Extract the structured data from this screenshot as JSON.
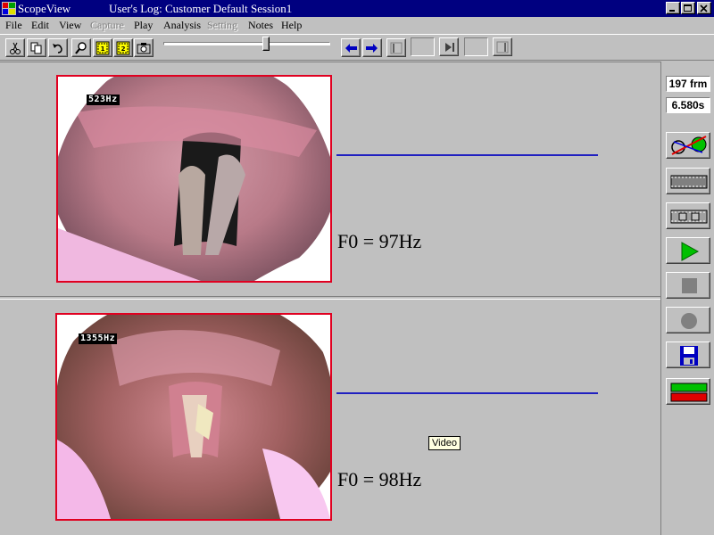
{
  "window": {
    "app_title": "ScopeView",
    "doc_title": "User's Log:  Customer Default Session1"
  },
  "menu": [
    "File",
    "Edit",
    "View",
    "Capture",
    "Play",
    "Analysis",
    "Setting",
    "Notes",
    "Help"
  ],
  "menu_disabled": [
    "Capture",
    "Setting"
  ],
  "toolbar": {
    "icons": [
      "cut-icon",
      "copy-icon",
      "undo-icon",
      "zoom-icon",
      "calibrate-1-icon",
      "calibrate-2-icon",
      "camera-icon"
    ],
    "slider_position": 0.62,
    "nav_icons": [
      "arrow-left-icon",
      "arrow-right-icon",
      "frame-start-icon",
      "frame-end-icon",
      "fullscreen-icon"
    ]
  },
  "panes": [
    {
      "frequency_overlay": "523Hz",
      "f0_text": "F0 = 97Hz"
    },
    {
      "frequency_overlay": "1355Hz",
      "f0_text": "F0 = 98Hz"
    }
  ],
  "tooltip": "Video",
  "status": {
    "frames": "197 frm",
    "duration": "6.580s"
  },
  "side_buttons": [
    "analysis-icon",
    "film-strip-icon",
    "film-strip-select-icon",
    "play-icon",
    "stop-icon",
    "record-icon",
    "save-icon",
    "level-bars-icon"
  ],
  "colors": {
    "title_bar": "#000080",
    "frame_border": "#e00020",
    "signal_line": "#2020c0",
    "play_green": "#00c000",
    "level_red": "#e00000",
    "level_green": "#00c000"
  }
}
